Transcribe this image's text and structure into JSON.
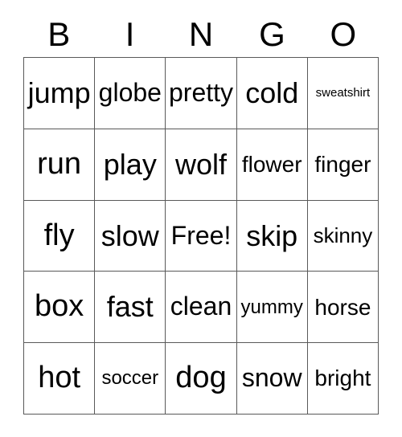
{
  "card": {
    "title": "BINGO",
    "free_space_label": "Free!",
    "border_color": "#595959",
    "background_color": "#ffffff",
    "text_color": "#000000"
  },
  "header": {
    "letters": [
      {
        "label": "B"
      },
      {
        "label": "I"
      },
      {
        "label": "N"
      },
      {
        "label": "G"
      },
      {
        "label": "O"
      }
    ]
  },
  "grid": {
    "rows": [
      {
        "cells": [
          {
            "label": "jump",
            "size": "sz-lg"
          },
          {
            "label": "globe",
            "size": "sz-md"
          },
          {
            "label": "pretty",
            "size": "sz-md"
          },
          {
            "label": "cold",
            "size": "sz-lg"
          },
          {
            "label": "sweatshirt",
            "size": "sz-tiny"
          }
        ]
      },
      {
        "cells": [
          {
            "label": "run",
            "size": "sz-xl"
          },
          {
            "label": "play",
            "size": "sz-lg"
          },
          {
            "label": "wolf",
            "size": "sz-lg"
          },
          {
            "label": "flower",
            "size": "sz-sm"
          },
          {
            "label": "finger",
            "size": "sz-sm"
          }
        ]
      },
      {
        "cells": [
          {
            "label": "fly",
            "size": "sz-xl"
          },
          {
            "label": "slow",
            "size": "sz-lg"
          },
          {
            "label": "Free!",
            "size": "sz-md",
            "is_free": true
          },
          {
            "label": "skip",
            "size": "sz-lg"
          },
          {
            "label": "skinny",
            "size": "sz-xs"
          }
        ]
      },
      {
        "cells": [
          {
            "label": "box",
            "size": "sz-xl"
          },
          {
            "label": "fast",
            "size": "sz-lg"
          },
          {
            "label": "clean",
            "size": "sz-md"
          },
          {
            "label": "yummy",
            "size": "sz-xxs"
          },
          {
            "label": "horse",
            "size": "sz-sm"
          }
        ]
      },
      {
        "cells": [
          {
            "label": "hot",
            "size": "sz-xl"
          },
          {
            "label": "soccer",
            "size": "sz-xxs"
          },
          {
            "label": "dog",
            "size": "sz-xl"
          },
          {
            "label": "snow",
            "size": "sz-md"
          },
          {
            "label": "bright",
            "size": "sz-sm"
          }
        ]
      }
    ]
  }
}
